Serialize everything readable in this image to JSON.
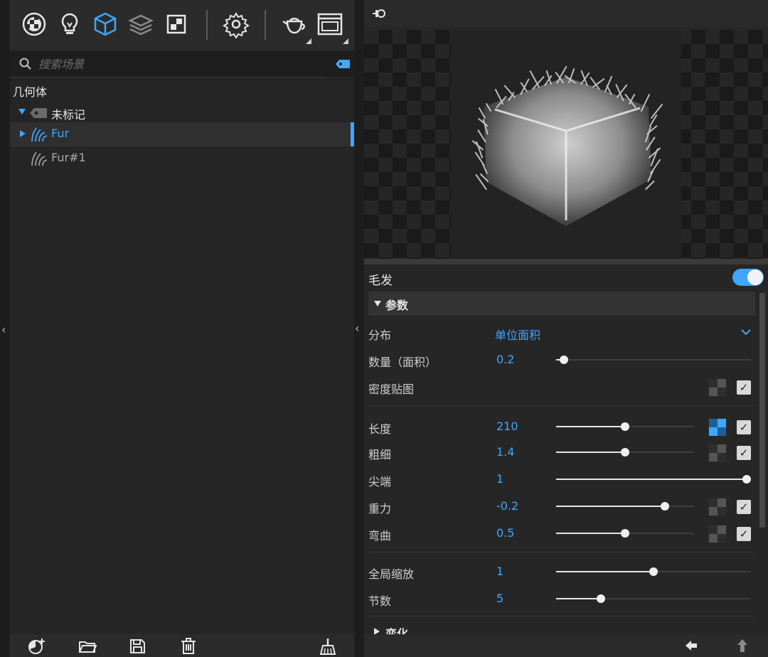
{
  "toolbar": {
    "icons": [
      "material-ball-icon",
      "light-bulb-icon",
      "cube-icon",
      "layers-icon",
      "texture-icon",
      "settings-gear-icon",
      "teapot-icon",
      "window-icon"
    ],
    "accent": "#3fa7ff"
  },
  "search": {
    "placeholder": "搜索场景"
  },
  "tree": {
    "heading": "几何体",
    "group_label": "未标记",
    "items": [
      {
        "label": "Fur",
        "selected": true
      },
      {
        "label": "Fur#1",
        "selected": false
      }
    ]
  },
  "left_footer": {
    "icons": [
      "add-material-icon",
      "open-folder-icon",
      "save-icon",
      "delete-icon",
      "clean-broom-icon"
    ]
  },
  "properties": {
    "title": "毛发",
    "enabled": true,
    "section_params": "参数",
    "distribution": {
      "label": "分布",
      "value": "单位面积"
    },
    "rows": [
      {
        "label": "数量（面积）",
        "value": "0.2",
        "fraction": 0.04
      },
      {
        "label": "密度贴图"
      },
      {
        "label": "长度",
        "value": "210",
        "fraction": 0.5
      },
      {
        "label": "粗细",
        "value": "1.4",
        "fraction": 0.5
      },
      {
        "label": "尖端",
        "value": "1",
        "fraction": 1.0
      },
      {
        "label": "重力",
        "value": "-0.2",
        "fraction": 0.79
      },
      {
        "label": "弯曲",
        "value": "0.5",
        "fraction": 0.5
      },
      {
        "label": "全局缩放",
        "value": "1",
        "fraction": 0.5
      },
      {
        "label": "节数",
        "value": "5",
        "fraction": 0.23
      }
    ],
    "section_transform": "变化"
  },
  "right_footer": {
    "icons": [
      "arrow-left-icon",
      "arrow-up-icon"
    ]
  }
}
